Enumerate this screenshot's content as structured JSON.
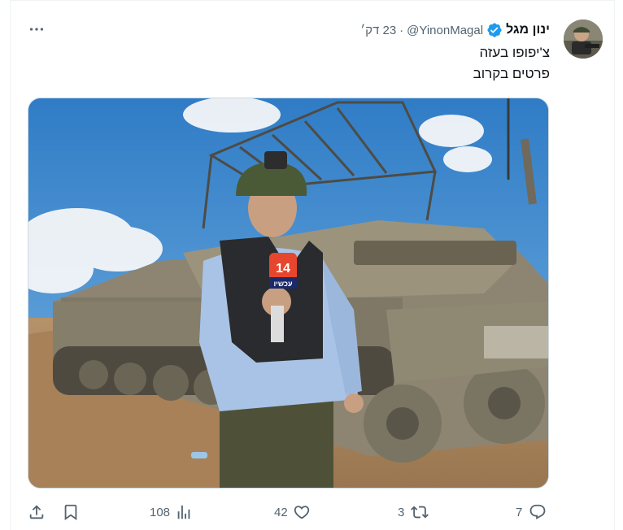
{
  "tweet": {
    "author": {
      "display_name": "ינון מגל",
      "handle": "@YinonMagal",
      "verified": true,
      "avatar_icon": "avatar-photo"
    },
    "separator": "·",
    "timestamp": "23 דק׳",
    "text_lines": [
      "צ'יפופו בעזה",
      "פרטים בקרוב"
    ],
    "media": {
      "description_icon": "photo-reporter-with-tank",
      "mic_flag_text": "14",
      "mic_flag_brand": "עכשיו"
    },
    "stats": {
      "replies": "7",
      "retweets": "3",
      "likes": "42",
      "views": "108"
    }
  },
  "colors": {
    "text_primary": "#0f1419",
    "text_secondary": "#536471",
    "verified_blue": "#1d9bf0",
    "border": "#eff3f4"
  }
}
